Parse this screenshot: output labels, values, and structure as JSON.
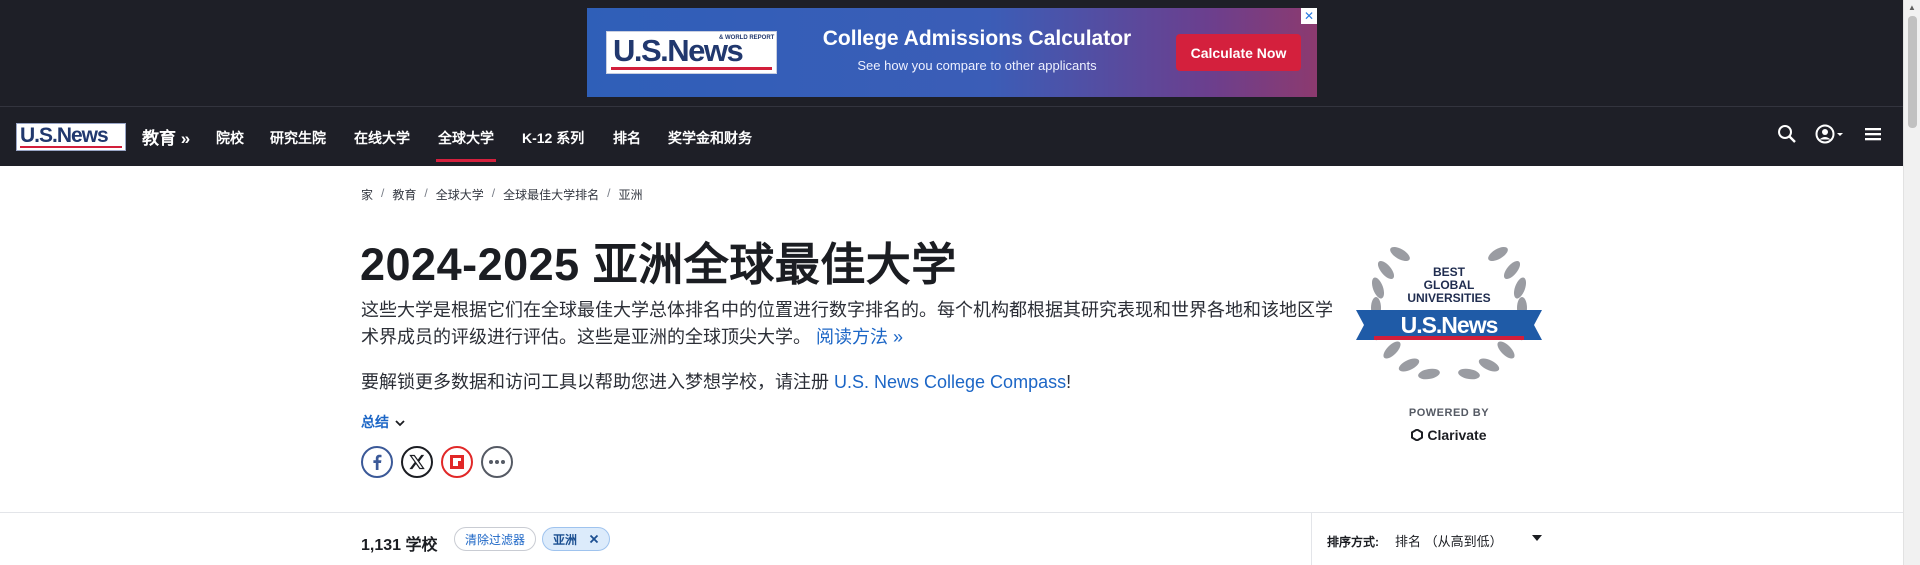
{
  "ad": {
    "logo_text": "U.S.News",
    "logo_sub": "& WORLD REPORT",
    "title": "College Admissions Calculator",
    "subtitle": "See how you compare to other applicants",
    "cta": "Calculate Now",
    "close": "✕"
  },
  "nav": {
    "logo_text": "U.S.News",
    "section": "教育 »",
    "links": [
      "院校",
      "研究生院",
      "在线大学",
      "全球大学",
      "K-12 系列",
      "排名",
      "奖学金和财务"
    ],
    "active_index": 3
  },
  "breadcrumb": [
    "家",
    "教育",
    "全球大学",
    "全球最佳大学排名",
    "亚洲"
  ],
  "page": {
    "title": "2024-2025 亚洲全球最佳大学",
    "description": "这些大学是根据它们在全球最佳大学总体排名中的位置进行数字排名的。每个机构都根据其研究表现和世界各地和该地区学术界成员的评级进行评估。这些是亚洲的全球顶尖大学。",
    "method_link": "阅读方法 »",
    "compass_prefix": "要解锁更多数据和访问工具以帮助您进入梦想学校，请注册 ",
    "compass_link": "U.S. News College Compass",
    "compass_suffix": "!",
    "summary": "总结"
  },
  "badge": {
    "line1": "BEST",
    "line2": "GLOBAL",
    "line3": "UNIVERSITIES",
    "logo": "U.S.News",
    "powered_by": "POWERED BY",
    "clarivate": "Clarivate"
  },
  "results": {
    "count": "1,131 学校",
    "clear_filters": "清除过滤器",
    "filter_chip": "亚洲",
    "sort_label": "排序方式:",
    "sort_value": "排名 （从高到低）"
  },
  "colors": {
    "dark_bg": "#1e1f27",
    "accent_red": "#d4203d",
    "link_blue": "#1c66c6"
  }
}
